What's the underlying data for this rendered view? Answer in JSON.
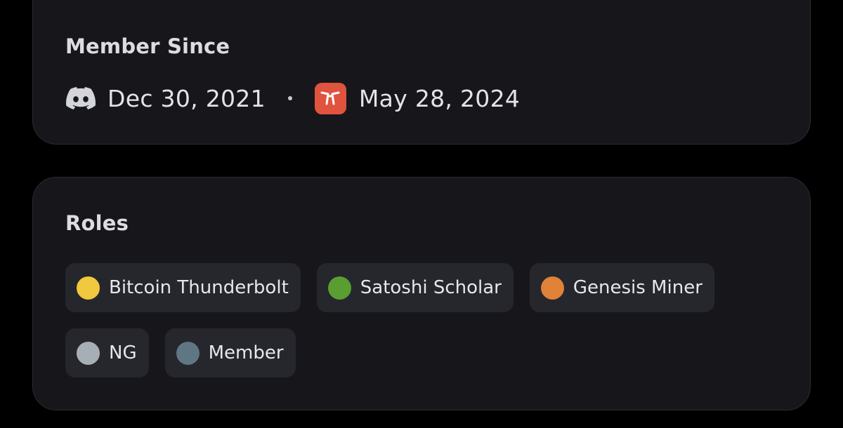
{
  "member_since": {
    "title": "Member Since",
    "discord": {
      "icon": "discord-icon",
      "date": "Dec 30, 2021"
    },
    "server": {
      "icon": "server-brand-icon",
      "date": "May 28, 2024",
      "color": "#e0533f"
    }
  },
  "roles": {
    "title": "Roles",
    "rows": [
      [
        {
          "label": "Bitcoin Thunderbolt",
          "color": "#f0c93e"
        },
        {
          "label": "Satoshi Scholar",
          "color": "#5a9e32"
        },
        {
          "label": "Genesis Miner",
          "color": "#e08238"
        }
      ],
      [
        {
          "label": "NG",
          "color": "#a7afb6"
        },
        {
          "label": "Member",
          "color": "#5f7685"
        }
      ]
    ]
  },
  "colors": {
    "background": "#000000",
    "card": "#17171b",
    "chip": "#26272c"
  }
}
